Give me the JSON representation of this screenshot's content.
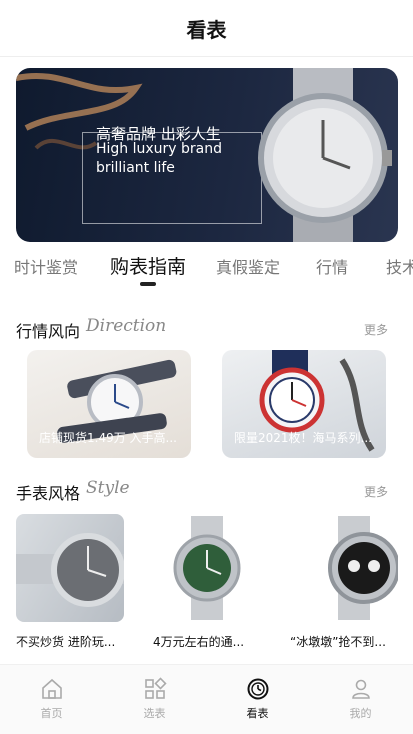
{
  "header": {
    "title": "看表"
  },
  "banner": {
    "title_cn": "高奢品牌 出彩人生",
    "title_en_line1": "High luxury brand",
    "title_en_line2": "brilliant life"
  },
  "tabs": [
    {
      "label": "时计鉴赏",
      "active": false
    },
    {
      "label": "购表指南",
      "active": true
    },
    {
      "label": "真假鉴定",
      "active": false
    },
    {
      "label": "行情",
      "active": false
    },
    {
      "label": "技术",
      "active": false
    }
  ],
  "market": {
    "title": "行情风向",
    "title_en": "Direction",
    "more": "更多",
    "cards": [
      {
        "caption": "店铺现货1.49万 入手高..."
      },
      {
        "caption": "限量2021枚！海马系列..."
      }
    ]
  },
  "style": {
    "title": "手表风格",
    "title_en": "Style",
    "more": "更多",
    "items": [
      {
        "caption": "不买炒货 进阶玩..."
      },
      {
        "caption": "4万元左右的通..."
      },
      {
        "caption": "“冰墩墩”抢不到..."
      }
    ]
  },
  "nav": [
    {
      "label": "首页",
      "icon": "home-icon",
      "active": false
    },
    {
      "label": "选表",
      "icon": "grid-icon",
      "active": false
    },
    {
      "label": "看表",
      "icon": "watch-icon",
      "active": true
    },
    {
      "label": "我的",
      "icon": "user-icon",
      "active": false
    }
  ],
  "colors": {
    "accent": "#111111",
    "inactive": "#aaaaaa",
    "banner_bg": "#1c2740"
  }
}
